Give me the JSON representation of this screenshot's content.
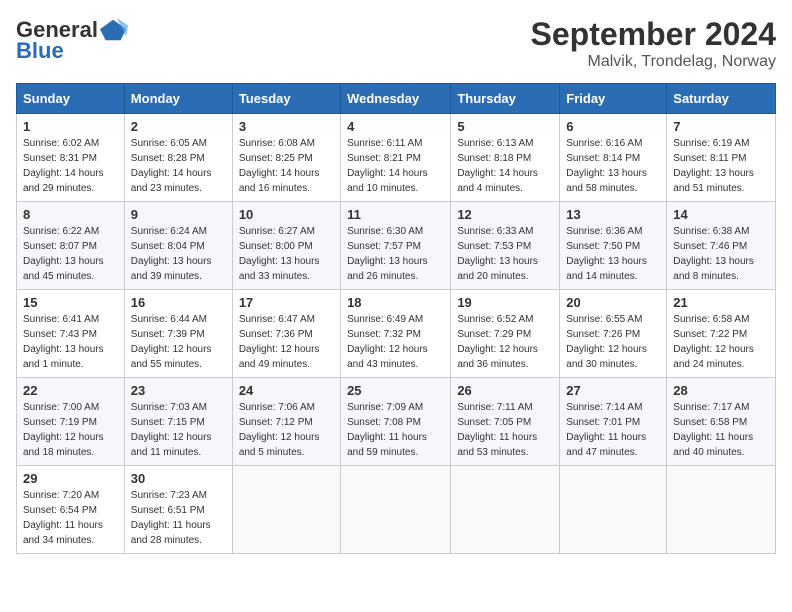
{
  "header": {
    "logo_general": "General",
    "logo_blue": "Blue",
    "month_year": "September 2024",
    "location": "Malvik, Trondelag, Norway"
  },
  "weekdays": [
    "Sunday",
    "Monday",
    "Tuesday",
    "Wednesday",
    "Thursday",
    "Friday",
    "Saturday"
  ],
  "weeks": [
    [
      {
        "day": 1,
        "sunrise": "6:02 AM",
        "sunset": "8:31 PM",
        "daylight": "14 hours and 29 minutes."
      },
      {
        "day": 2,
        "sunrise": "6:05 AM",
        "sunset": "8:28 PM",
        "daylight": "14 hours and 23 minutes."
      },
      {
        "day": 3,
        "sunrise": "6:08 AM",
        "sunset": "8:25 PM",
        "daylight": "14 hours and 16 minutes."
      },
      {
        "day": 4,
        "sunrise": "6:11 AM",
        "sunset": "8:21 PM",
        "daylight": "14 hours and 10 minutes."
      },
      {
        "day": 5,
        "sunrise": "6:13 AM",
        "sunset": "8:18 PM",
        "daylight": "14 hours and 4 minutes."
      },
      {
        "day": 6,
        "sunrise": "6:16 AM",
        "sunset": "8:14 PM",
        "daylight": "13 hours and 58 minutes."
      },
      {
        "day": 7,
        "sunrise": "6:19 AM",
        "sunset": "8:11 PM",
        "daylight": "13 hours and 51 minutes."
      }
    ],
    [
      {
        "day": 8,
        "sunrise": "6:22 AM",
        "sunset": "8:07 PM",
        "daylight": "13 hours and 45 minutes."
      },
      {
        "day": 9,
        "sunrise": "6:24 AM",
        "sunset": "8:04 PM",
        "daylight": "13 hours and 39 minutes."
      },
      {
        "day": 10,
        "sunrise": "6:27 AM",
        "sunset": "8:00 PM",
        "daylight": "13 hours and 33 minutes."
      },
      {
        "day": 11,
        "sunrise": "6:30 AM",
        "sunset": "7:57 PM",
        "daylight": "13 hours and 26 minutes."
      },
      {
        "day": 12,
        "sunrise": "6:33 AM",
        "sunset": "7:53 PM",
        "daylight": "13 hours and 20 minutes."
      },
      {
        "day": 13,
        "sunrise": "6:36 AM",
        "sunset": "7:50 PM",
        "daylight": "13 hours and 14 minutes."
      },
      {
        "day": 14,
        "sunrise": "6:38 AM",
        "sunset": "7:46 PM",
        "daylight": "13 hours and 8 minutes."
      }
    ],
    [
      {
        "day": 15,
        "sunrise": "6:41 AM",
        "sunset": "7:43 PM",
        "daylight": "13 hours and 1 minute."
      },
      {
        "day": 16,
        "sunrise": "6:44 AM",
        "sunset": "7:39 PM",
        "daylight": "12 hours and 55 minutes."
      },
      {
        "day": 17,
        "sunrise": "6:47 AM",
        "sunset": "7:36 PM",
        "daylight": "12 hours and 49 minutes."
      },
      {
        "day": 18,
        "sunrise": "6:49 AM",
        "sunset": "7:32 PM",
        "daylight": "12 hours and 43 minutes."
      },
      {
        "day": 19,
        "sunrise": "6:52 AM",
        "sunset": "7:29 PM",
        "daylight": "12 hours and 36 minutes."
      },
      {
        "day": 20,
        "sunrise": "6:55 AM",
        "sunset": "7:26 PM",
        "daylight": "12 hours and 30 minutes."
      },
      {
        "day": 21,
        "sunrise": "6:58 AM",
        "sunset": "7:22 PM",
        "daylight": "12 hours and 24 minutes."
      }
    ],
    [
      {
        "day": 22,
        "sunrise": "7:00 AM",
        "sunset": "7:19 PM",
        "daylight": "12 hours and 18 minutes."
      },
      {
        "day": 23,
        "sunrise": "7:03 AM",
        "sunset": "7:15 PM",
        "daylight": "12 hours and 11 minutes."
      },
      {
        "day": 24,
        "sunrise": "7:06 AM",
        "sunset": "7:12 PM",
        "daylight": "12 hours and 5 minutes."
      },
      {
        "day": 25,
        "sunrise": "7:09 AM",
        "sunset": "7:08 PM",
        "daylight": "11 hours and 59 minutes."
      },
      {
        "day": 26,
        "sunrise": "7:11 AM",
        "sunset": "7:05 PM",
        "daylight": "11 hours and 53 minutes."
      },
      {
        "day": 27,
        "sunrise": "7:14 AM",
        "sunset": "7:01 PM",
        "daylight": "11 hours and 47 minutes."
      },
      {
        "day": 28,
        "sunrise": "7:17 AM",
        "sunset": "6:58 PM",
        "daylight": "11 hours and 40 minutes."
      }
    ],
    [
      {
        "day": 29,
        "sunrise": "7:20 AM",
        "sunset": "6:54 PM",
        "daylight": "11 hours and 34 minutes."
      },
      {
        "day": 30,
        "sunrise": "7:23 AM",
        "sunset": "6:51 PM",
        "daylight": "11 hours and 28 minutes."
      },
      null,
      null,
      null,
      null,
      null
    ]
  ]
}
